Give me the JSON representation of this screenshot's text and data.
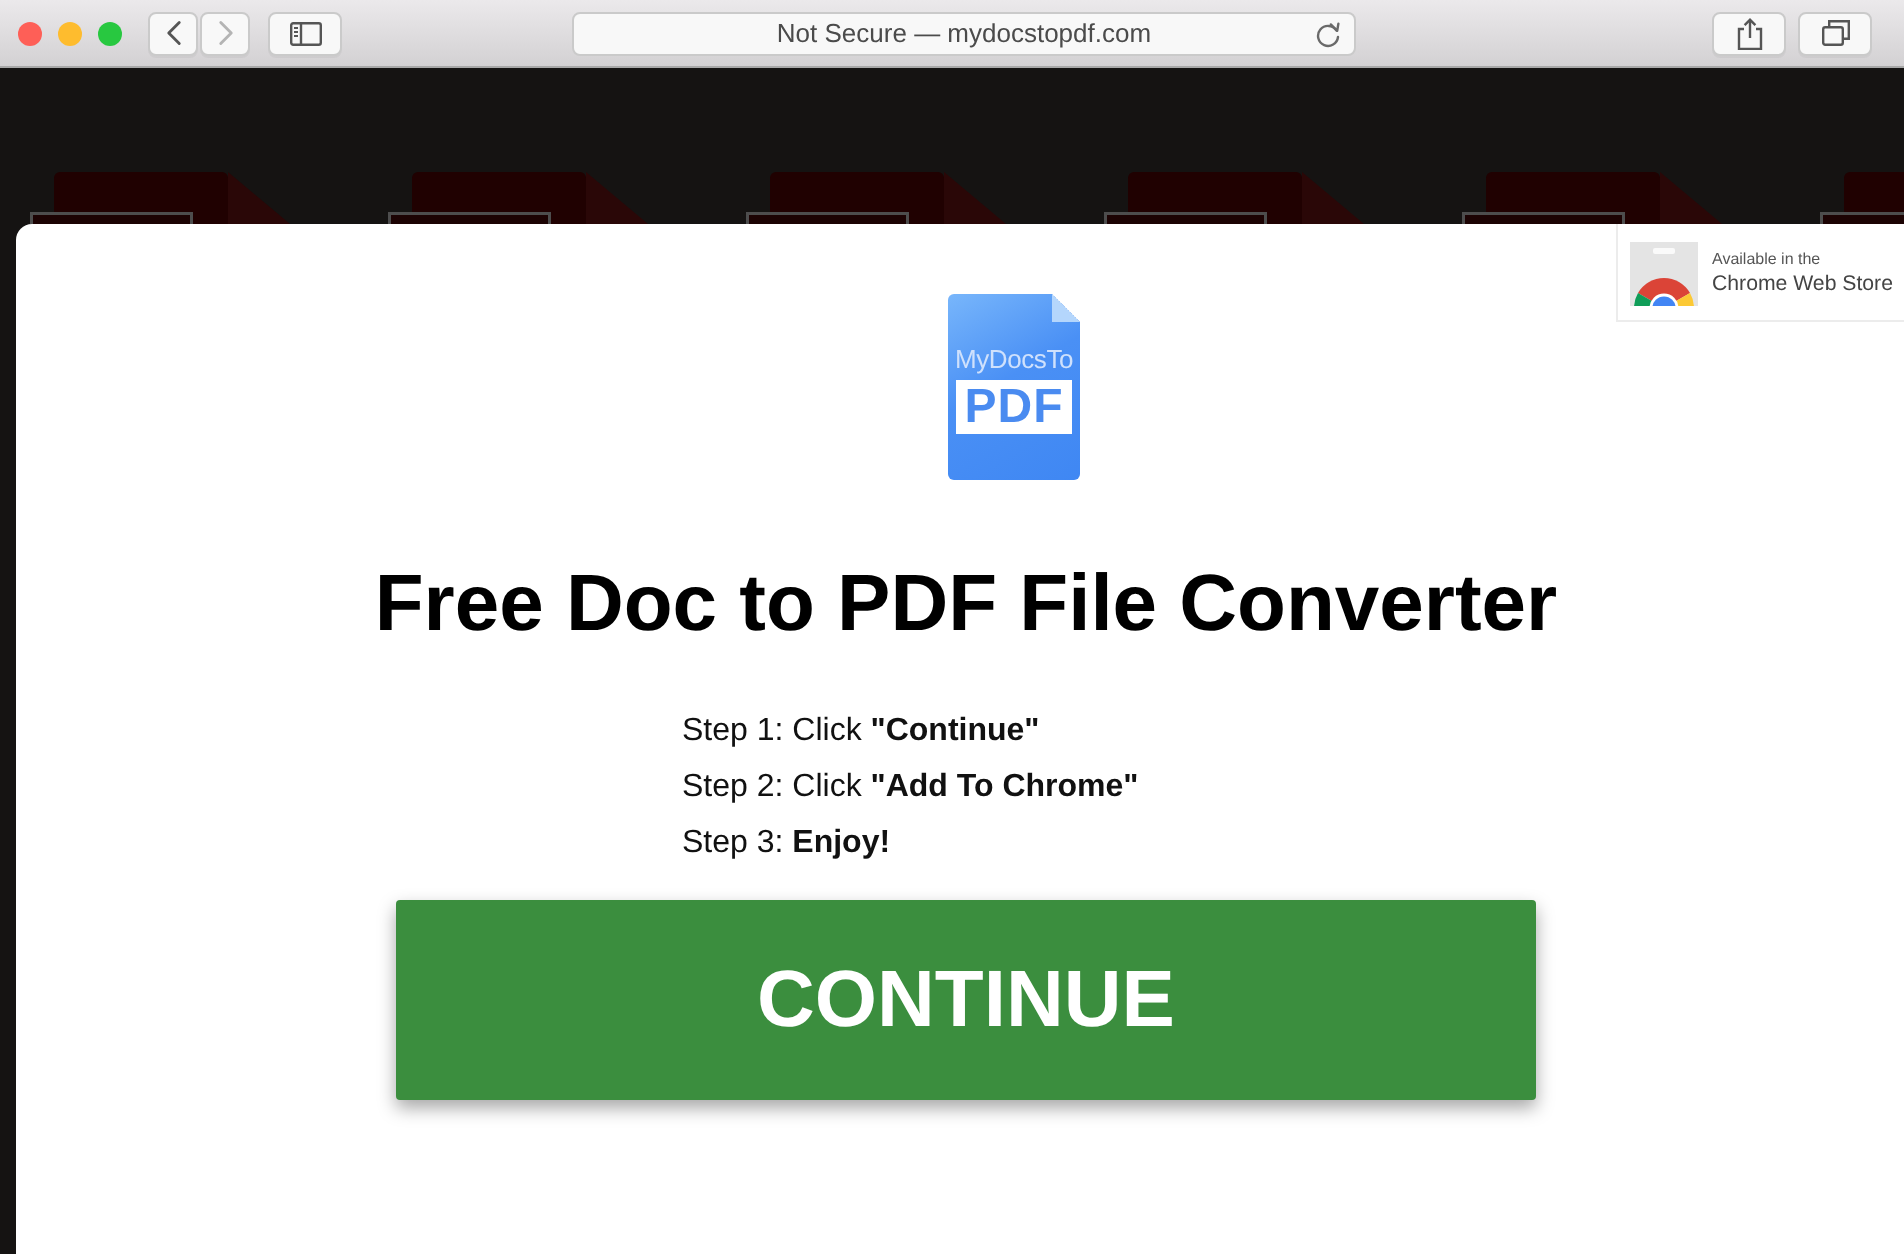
{
  "browser": {
    "back": {
      "disabled": false
    },
    "forward": {
      "disabled": true
    },
    "address": "Not Secure — mydocstopdf.com"
  },
  "store_badge": {
    "line_1": "Available in the",
    "line_2": "Chrome Web Store"
  },
  "logo": {
    "line_1": "MyDocsTo",
    "line_2": "PDF"
  },
  "title": "Free Doc to PDF File Converter",
  "steps": [
    "Step 1: Click **\"Continue\"**",
    "Step 2: Click **\"Add To Chrome\"**",
    "Step 3: **Enjoy!**"
  ],
  "button": "CONTINUE"
}
